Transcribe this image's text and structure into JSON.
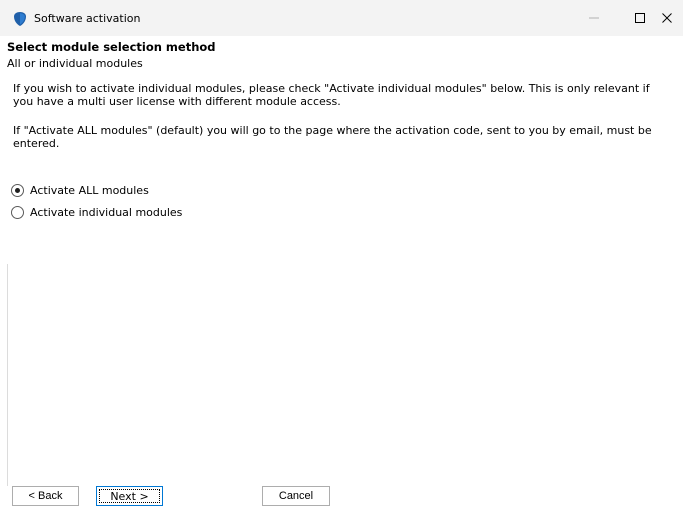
{
  "window": {
    "title": "Software activation",
    "controls": {
      "minimize_glyph": "—",
      "maximize_glyph": "☐",
      "close_glyph": "✕"
    }
  },
  "header": {
    "title": "Select module selection method",
    "subtitle": "All or individual modules"
  },
  "body": {
    "paragraph1": "If you wish to activate individual modules, please check \"Activate individual modules\" below. This is only relevant if you have a multi user license with different module access.",
    "paragraph2": "If \"Activate ALL modules\" (default) you will go to the page where the activation code, sent to you by email, must be entered."
  },
  "options": [
    {
      "label": "Activate ALL modules",
      "selected": true
    },
    {
      "label": "Activate individual modules",
      "selected": false
    }
  ],
  "buttons": {
    "back": "< Back",
    "next": "Next >",
    "cancel": "Cancel"
  },
  "colors": {
    "titlebar": "#f3f3f3",
    "icon_blue": "#1f5fa8",
    "focus_blue": "#0078d4"
  }
}
